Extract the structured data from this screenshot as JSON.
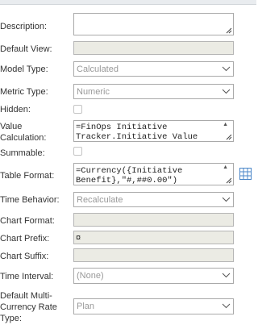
{
  "labels": {
    "description": "Description:",
    "default_view": "Default View:",
    "model_type": "Model Type:",
    "metric_type": "Metric Type:",
    "hidden": "Hidden:",
    "value_calc_1": "Value",
    "value_calc_2": "Calculation:",
    "summable": "Summable:",
    "table_format": "Table Format:",
    "time_behavior": "Time Behavior:",
    "chart_format": "Chart Format:",
    "chart_prefix": "Chart Prefix:",
    "chart_suffix": "Chart Suffix:",
    "time_interval": "Time Interval:",
    "multi_1": "Default Multi-",
    "multi_2": "Currency Rate",
    "multi_3": "Type:"
  },
  "fields": {
    "description": "",
    "default_view": "",
    "model_type": "Calculated",
    "metric_type": "Numeric",
    "hidden": false,
    "value_calc_line1": "=FinOps Initiative",
    "value_calc_line2": "Tracker.Initiative Value",
    "summable": false,
    "table_format_line1": "=Currency({Initiative",
    "table_format_line2": "Benefit},\"#,##0.00\")",
    "time_behavior": "Recalculate",
    "chart_format": "",
    "chart_prefix": "¤",
    "chart_suffix": "",
    "time_interval": "(None)",
    "multi_currency_rate_type": "Plan"
  },
  "icons": {
    "dropdown": "chevron-down-icon",
    "resize": "resize-grip-icon",
    "table_format_builder": "grid-icon"
  },
  "colors": {
    "disabled_bg": "#ebebe4",
    "border": "#a9a9a9",
    "placeholder_text": "#999999",
    "grid_icon": "#4a86c8"
  }
}
